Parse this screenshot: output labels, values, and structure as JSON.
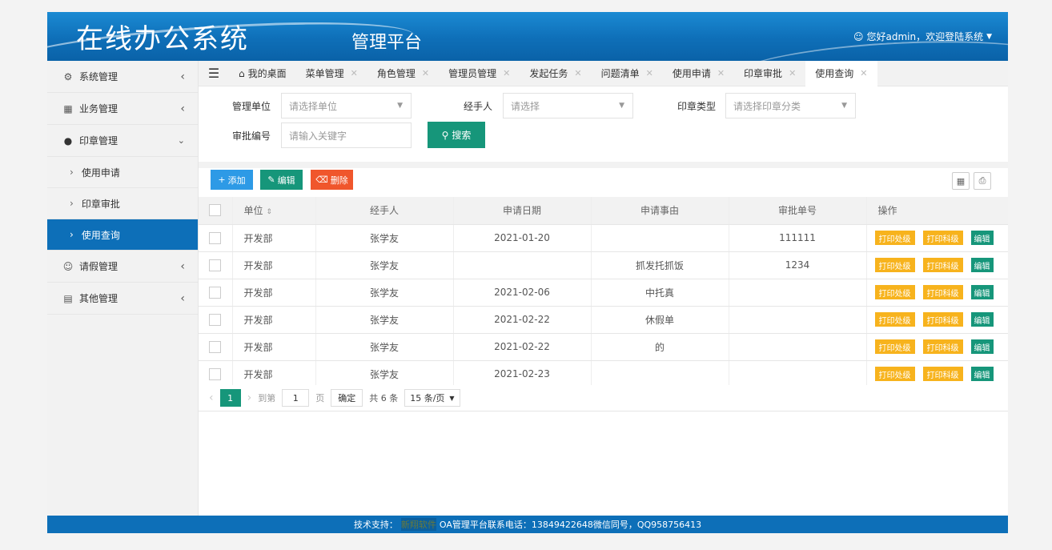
{
  "header": {
    "logo": "在线办公系统",
    "platform": "管理平台",
    "user_text": "您好admin，欢迎登陆系统"
  },
  "sidebar": {
    "items": [
      {
        "label": "系统管理",
        "icon": "gear-icon"
      },
      {
        "label": "业务管理",
        "icon": "grid-icon"
      },
      {
        "label": "印章管理",
        "icon": "circle-icon"
      }
    ],
    "sub_items": [
      {
        "label": "使用申请"
      },
      {
        "label": "印章审批"
      },
      {
        "label": "使用查询"
      }
    ],
    "bottom_items": [
      {
        "label": "请假管理",
        "icon": "user-icon"
      },
      {
        "label": "其他管理",
        "icon": "doc-icon"
      }
    ]
  },
  "tabs": [
    {
      "label": "我的桌面"
    },
    {
      "label": "菜单管理"
    },
    {
      "label": "角色管理"
    },
    {
      "label": "管理员管理"
    },
    {
      "label": "发起任务"
    },
    {
      "label": "问题清单"
    },
    {
      "label": "使用申请"
    },
    {
      "label": "印章审批"
    },
    {
      "label": "使用查询"
    }
  ],
  "search": {
    "unit_label": "管理单位",
    "unit_placeholder": "请选择单位",
    "handler_label": "经手人",
    "handler_placeholder": "请选择",
    "type_label": "印章类型",
    "type_placeholder": "请选择印章分类",
    "approval_label": "审批编号",
    "approval_placeholder": "请输入关键字",
    "search_button": "搜索"
  },
  "toolbar": {
    "add_label": "添加",
    "edit_label": "编辑",
    "delete_label": "删除"
  },
  "table": {
    "headers": [
      "单位",
      "经手人",
      "申请日期",
      "申请事由",
      "审批单号",
      "操作"
    ],
    "op_print_seal": "打印处级",
    "op_print_section": "打印科级",
    "op_edit": "编辑",
    "rows": [
      {
        "unit": "开发部",
        "handler": "张学友",
        "date": "2021-01-20",
        "reason": "",
        "approval": "111111"
      },
      {
        "unit": "开发部",
        "handler": "张学友",
        "date": "",
        "reason": "抓发托抓饭",
        "approval": "1234"
      },
      {
        "unit": "开发部",
        "handler": "张学友",
        "date": "2021-02-06",
        "reason": "中托真",
        "approval": ""
      },
      {
        "unit": "开发部",
        "handler": "张学友",
        "date": "2021-02-22",
        "reason": "休假单",
        "approval": ""
      },
      {
        "unit": "开发部",
        "handler": "张学友",
        "date": "2021-02-22",
        "reason": "的",
        "approval": ""
      },
      {
        "unit": "开发部",
        "handler": "张学友",
        "date": "2021-02-23",
        "reason": "",
        "approval": ""
      }
    ]
  },
  "pager": {
    "current": "1",
    "goto_label": "到第",
    "goto_value": "1",
    "page_label": "页",
    "confirm": "确定",
    "total": "共 6 条",
    "page_size": "15 条/页"
  },
  "footer": {
    "prefix": "技术支持：",
    "brand": "新翔软件",
    "text": "OA管理平台联系电话：13849422648微信同号，QQ958756413"
  }
}
